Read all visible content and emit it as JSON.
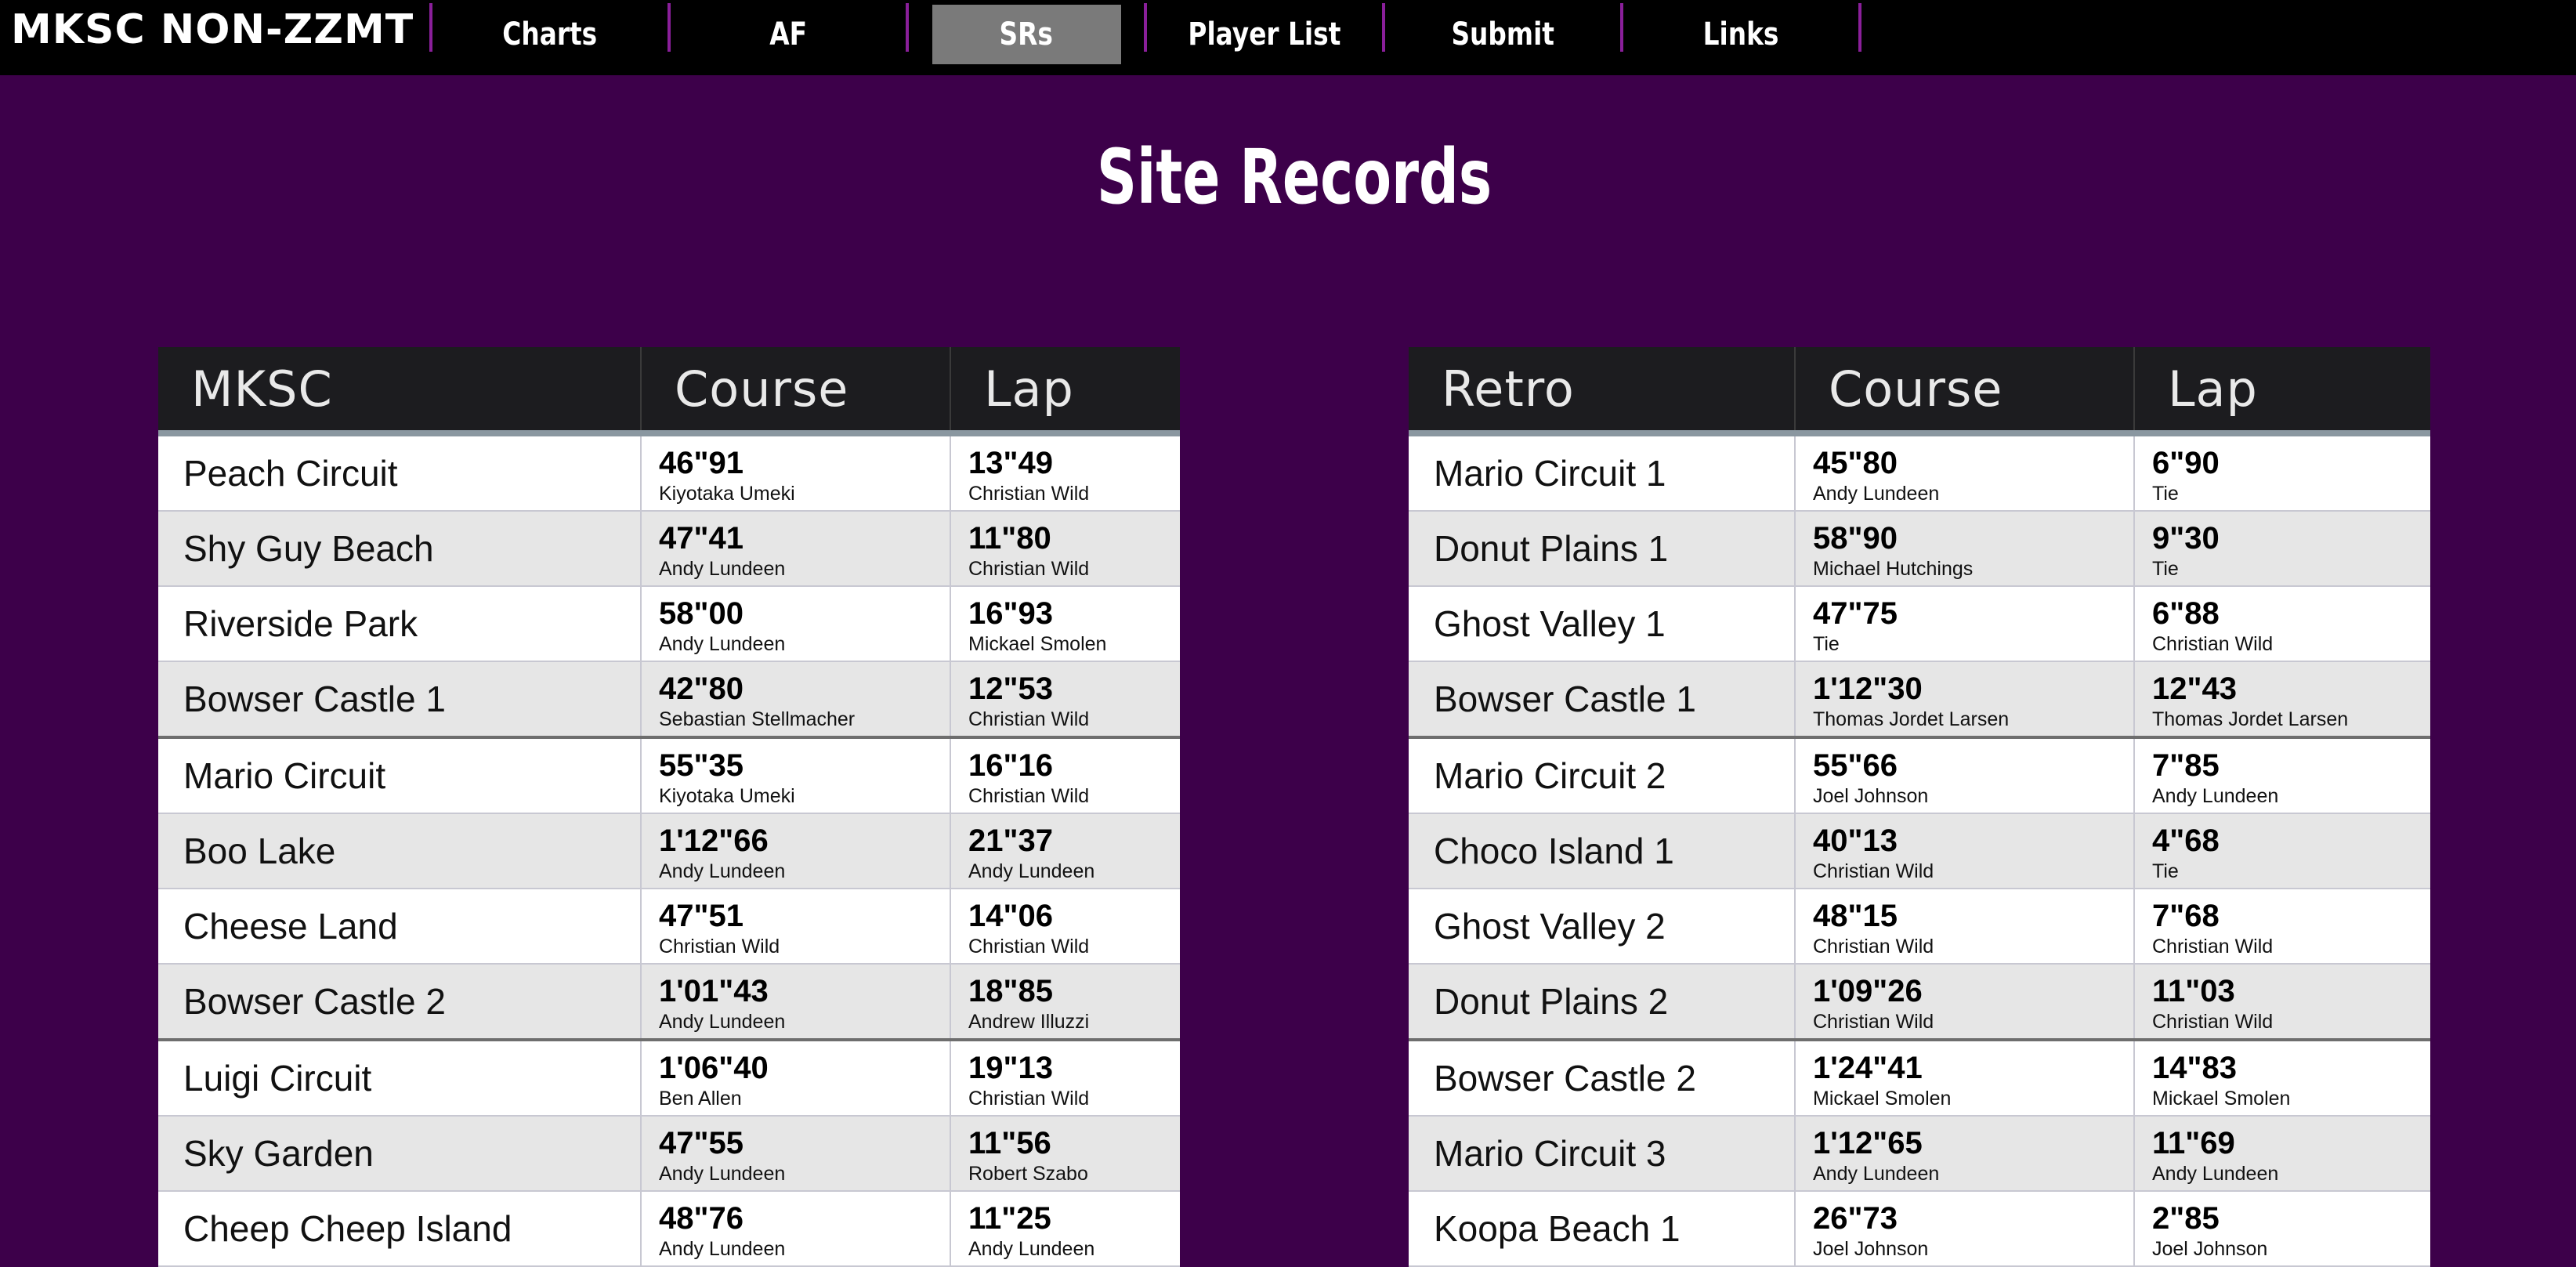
{
  "nav": {
    "logo": "MKSC NON-ZZMT",
    "items": [
      {
        "label": "Charts",
        "active": false
      },
      {
        "label": "AF",
        "active": false
      },
      {
        "label": "SRs",
        "active": true
      },
      {
        "label": "Player List",
        "active": false
      },
      {
        "label": "Submit",
        "active": false
      },
      {
        "label": "Links",
        "active": false
      }
    ]
  },
  "page": {
    "title": "Site Records"
  },
  "colors": {
    "background": "#3d004a",
    "topbar": "#000000",
    "active_tab": "#7a7a7a",
    "table_header": "#1c1c1f"
  },
  "tables": [
    {
      "headers": [
        "MKSC",
        "Course",
        "Lap"
      ],
      "rows": [
        {
          "name": "Peach Circuit",
          "course": "46\"91",
          "course_player": "Kiyotaka Umeki",
          "lap": "13\"49",
          "lap_player": "Christian Wild"
        },
        {
          "name": "Shy Guy Beach",
          "course": "47\"41",
          "course_player": "Andy Lundeen",
          "lap": "11\"80",
          "lap_player": "Christian Wild"
        },
        {
          "name": "Riverside Park",
          "course": "58\"00",
          "course_player": "Andy Lundeen",
          "lap": "16\"93",
          "lap_player": "Mickael Smolen"
        },
        {
          "name": "Bowser Castle 1",
          "course": "42\"80",
          "course_player": "Sebastian Stellmacher",
          "lap": "12\"53",
          "lap_player": "Christian Wild"
        },
        {
          "name": "Mario Circuit",
          "course": "55\"35",
          "course_player": "Kiyotaka Umeki",
          "lap": "16\"16",
          "lap_player": "Christian Wild"
        },
        {
          "name": "Boo Lake",
          "course": "1'12\"66",
          "course_player": "Andy Lundeen",
          "lap": "21\"37",
          "lap_player": "Andy Lundeen"
        },
        {
          "name": "Cheese Land",
          "course": "47\"51",
          "course_player": "Christian Wild",
          "lap": "14\"06",
          "lap_player": "Christian Wild"
        },
        {
          "name": "Bowser Castle 2",
          "course": "1'01\"43",
          "course_player": "Andy Lundeen",
          "lap": "18\"85",
          "lap_player": "Andrew Illuzzi"
        },
        {
          "name": "Luigi Circuit",
          "course": "1'06\"40",
          "course_player": "Ben Allen",
          "lap": "19\"13",
          "lap_player": "Christian Wild"
        },
        {
          "name": "Sky Garden",
          "course": "47\"55",
          "course_player": "Andy Lundeen",
          "lap": "11\"56",
          "lap_player": "Robert Szabo"
        },
        {
          "name": "Cheep Cheep Island",
          "course": "48\"76",
          "course_player": "Andy Lundeen",
          "lap": "11\"25",
          "lap_player": "Andy Lundeen"
        }
      ]
    },
    {
      "headers": [
        "Retro",
        "Course",
        "Lap"
      ],
      "rows": [
        {
          "name": "Mario Circuit 1",
          "course": "45\"80",
          "course_player": "Andy Lundeen",
          "lap": "6\"90",
          "lap_player": "Tie"
        },
        {
          "name": "Donut Plains 1",
          "course": "58\"90",
          "course_player": "Michael Hutchings",
          "lap": "9\"30",
          "lap_player": "Tie"
        },
        {
          "name": "Ghost Valley 1",
          "course": "47\"75",
          "course_player": "Tie",
          "lap": "6\"88",
          "lap_player": "Christian Wild"
        },
        {
          "name": "Bowser Castle 1",
          "course": "1'12\"30",
          "course_player": "Thomas Jordet Larsen",
          "lap": "12\"43",
          "lap_player": "Thomas Jordet Larsen"
        },
        {
          "name": "Mario Circuit 2",
          "course": "55\"66",
          "course_player": "Joel Johnson",
          "lap": "7\"85",
          "lap_player": "Andy Lundeen"
        },
        {
          "name": "Choco Island 1",
          "course": "40\"13",
          "course_player": "Christian Wild",
          "lap": "4\"68",
          "lap_player": "Tie"
        },
        {
          "name": "Ghost Valley 2",
          "course": "48\"15",
          "course_player": "Christian Wild",
          "lap": "7\"68",
          "lap_player": "Christian Wild"
        },
        {
          "name": "Donut Plains 2",
          "course": "1'09\"26",
          "course_player": "Christian Wild",
          "lap": "11\"03",
          "lap_player": "Christian Wild"
        },
        {
          "name": "Bowser Castle 2",
          "course": "1'24\"41",
          "course_player": "Mickael Smolen",
          "lap": "14\"83",
          "lap_player": "Mickael Smolen"
        },
        {
          "name": "Mario Circuit 3",
          "course": "1'12\"65",
          "course_player": "Andy Lundeen",
          "lap": "11\"69",
          "lap_player": "Andy Lundeen"
        },
        {
          "name": "Koopa Beach 1",
          "course": "26\"73",
          "course_player": "Joel Johnson",
          "lap": "2\"85",
          "lap_player": "Joel Johnson"
        }
      ]
    }
  ]
}
